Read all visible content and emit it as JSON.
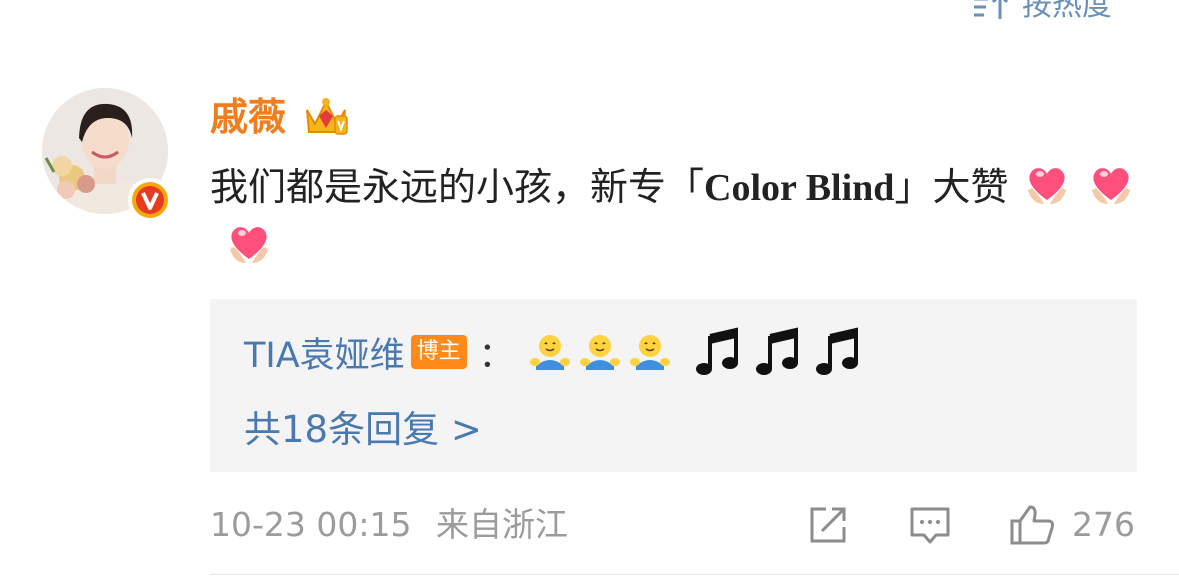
{
  "sort": {
    "label": "按热度",
    "icon": "sort-icon"
  },
  "comment": {
    "author": "戚薇",
    "avatar_icon": "avatar",
    "verified_icon": "verified-v-badge",
    "crown_icon": "vip-crown-icon",
    "text_before": "我们都是永远的小孩，新专「",
    "text_en": "Color Blind",
    "text_after": "」大赞",
    "emoji": [
      "heart-hands-emoji",
      "heart-hands-emoji",
      "heart-hands-emoji"
    ]
  },
  "reply": {
    "author": "TIA袁娅维",
    "badge": "博主",
    "colon": "：",
    "emoji": [
      "hug-emoji",
      "hug-emoji",
      "hug-emoji",
      "music-note-emoji",
      "music-note-emoji",
      "music-note-emoji"
    ],
    "more_label": "共18条回复 >"
  },
  "footer": {
    "date": "10-23 00:15",
    "location": "来自浙江",
    "share_icon": "share-icon",
    "comment_icon": "comment-icon",
    "like_icon": "like-icon",
    "like_count": "276"
  },
  "colors": {
    "name": "#f07d1e",
    "link": "#4a79b0",
    "meta": "#9b9b9b",
    "badge": "#ff8a1a"
  }
}
